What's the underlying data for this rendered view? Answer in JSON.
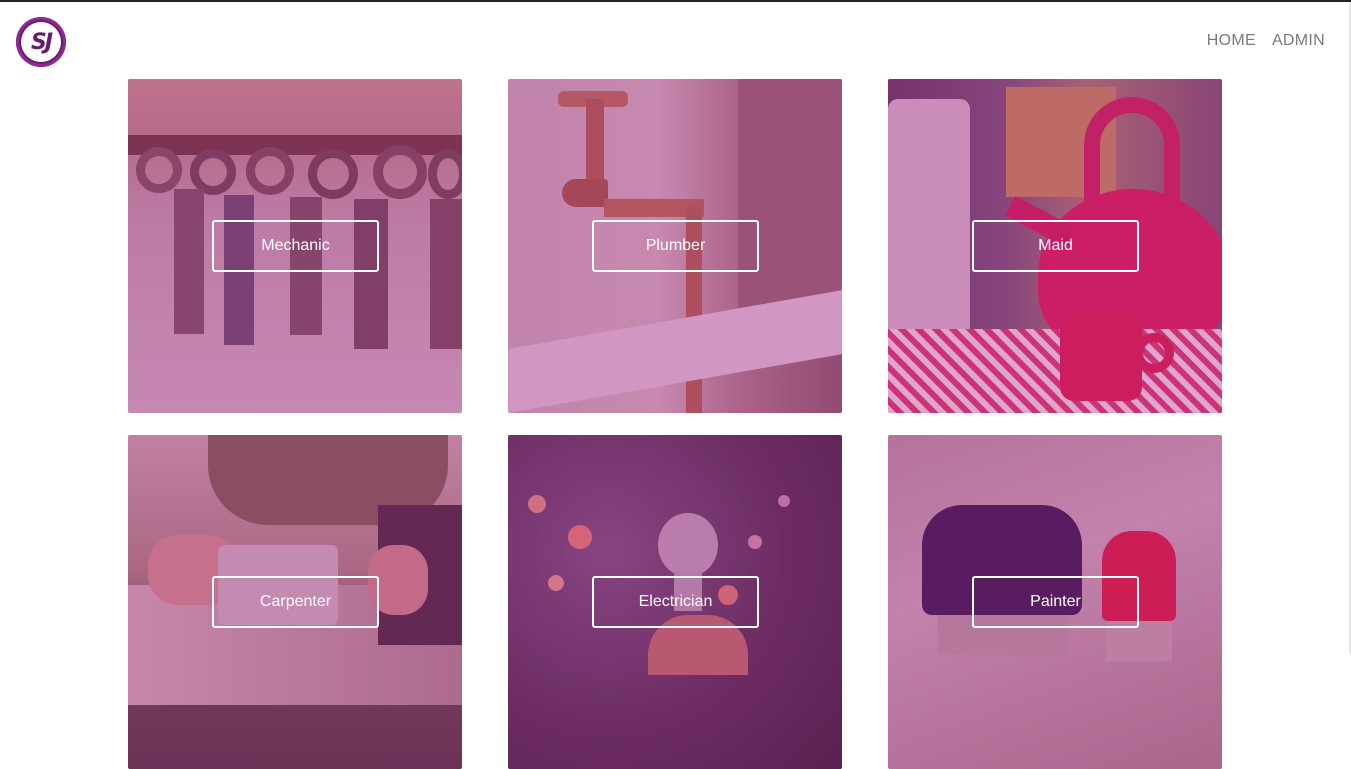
{
  "header": {
    "logo_text": "SJ",
    "nav": [
      {
        "label": "HOME"
      },
      {
        "label": "ADMIN"
      }
    ]
  },
  "services": [
    {
      "label": "Mechanic",
      "image": "wrenches"
    },
    {
      "label": "Plumber",
      "image": "copper-tap"
    },
    {
      "label": "Maid",
      "image": "red-teapot"
    },
    {
      "label": "Carpenter",
      "image": "saw-hands"
    },
    {
      "label": "Electrician",
      "image": "light-bulb"
    },
    {
      "label": "Painter",
      "image": "paint-brushes"
    }
  ],
  "colors": {
    "brand": "#6a1b6e",
    "overlay": "#b0288c",
    "nav_text": "#7a7a7a"
  }
}
